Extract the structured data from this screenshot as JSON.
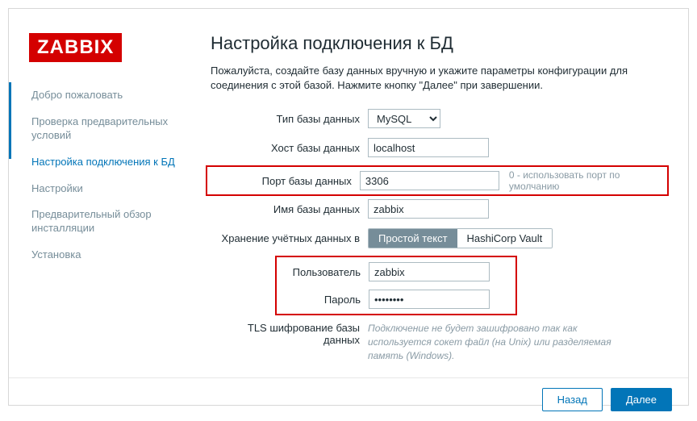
{
  "logo": "ZABBIX",
  "sidebar": {
    "steps": [
      "Добро пожаловать",
      "Проверка предварительных условий",
      "Настройка подключения к БД",
      "Настройки",
      "Предварительный обзор инсталляции",
      "Установка"
    ]
  },
  "main": {
    "title": "Настройка подключения к БД",
    "intro": "Пожалуйста, создайте базу данных вручную и укажите параметры конфигурации для соединения с этой базой. Нажмите кнопку \"Далее\" при завершении.",
    "labels": {
      "db_type": "Тип базы данных",
      "db_host": "Хост базы данных",
      "db_port": "Порт базы данных",
      "db_name": "Имя базы данных",
      "store_in": "Хранение учётных данных в",
      "user": "Пользователь",
      "password": "Пароль",
      "tls": "TLS шифрование базы данных"
    },
    "values": {
      "db_type": "MySQL",
      "db_host": "localhost",
      "db_port": "3306",
      "db_name": "zabbix",
      "user": "zabbix",
      "password": "••••••••"
    },
    "toggle": {
      "plain": "Простой текст",
      "vault": "HashiCorp Vault"
    },
    "port_hint": "0 - использовать порт по умолчанию",
    "tls_hint": "Подключение не будет зашифровано так как используется сокет файл (на Unix) или разделяемая память (Windows)."
  },
  "footer": {
    "back": "Назад",
    "next": "Далее"
  }
}
